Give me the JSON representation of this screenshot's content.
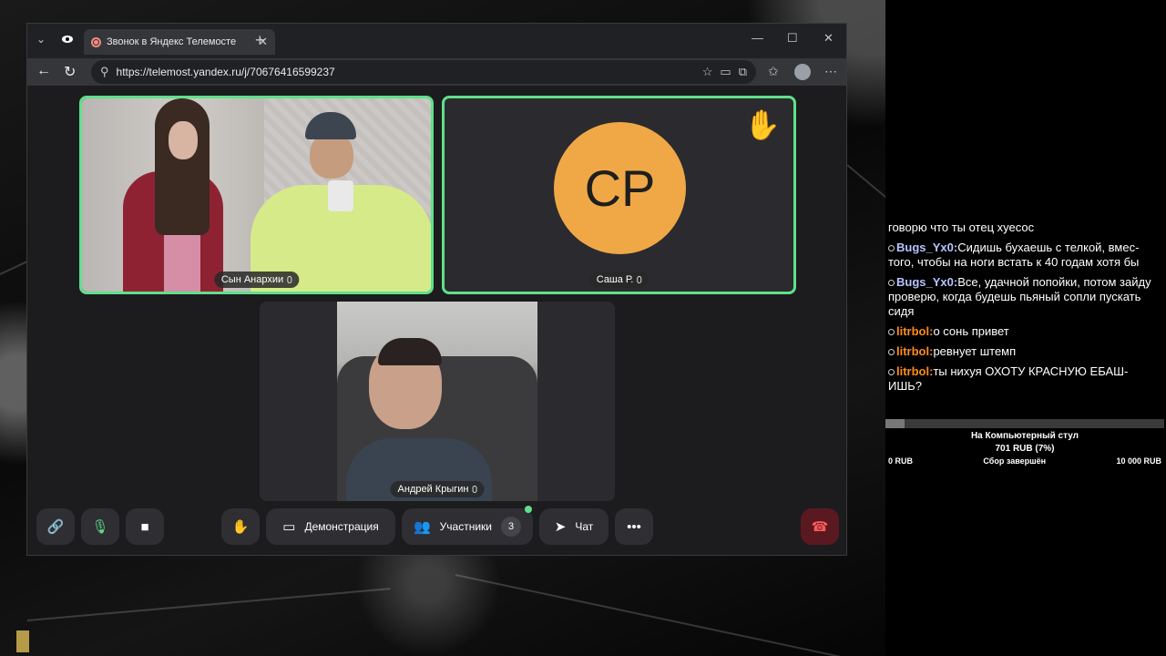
{
  "browser": {
    "tab_title": "Звонок в Яндекс Телемосте",
    "tab_close": "✕",
    "new_tab": "+",
    "url": "https://telemost.yandex.ru/j/70676416599237",
    "minimize": "—",
    "maximize": "☐",
    "close": "✕"
  },
  "call": {
    "participants": [
      {
        "name": "Сын Анархии",
        "speaking": true
      },
      {
        "name": "Саша Р.",
        "initials": "СР",
        "speaking": true,
        "hand_raised": true,
        "avatar_color": "#f0a847"
      },
      {
        "name": "Андрей Крыгин",
        "speaking": false
      }
    ],
    "controls": {
      "demo_label": "Демонстрация",
      "participants_label": "Участники",
      "participants_count": "3",
      "chat_label": "Чат",
      "more": "•••"
    },
    "accent_color": "#5fe08a"
  },
  "chat": {
    "messages": [
      {
        "user": "",
        "text": "говорю что ты отец хуесос"
      },
      {
        "user": "Bugs_Yx0:",
        "text": "Сидишь бухаешь с телкой, вмес-того, чтобы на ноги встать к 40 годам хотя бы"
      },
      {
        "user": "Bugs_Yx0:",
        "text": "Все, удачной попойки, потом зайду проверю, когда будешь пьяный сопли пускать сидя"
      },
      {
        "user": "litrbol:",
        "text": "о сонь привет"
      },
      {
        "user": "litrbol:",
        "text": "ревнует штемп"
      },
      {
        "user": "litrbol:",
        "text": "ты нихуя ОХОТУ КРАСНУЮ ЕБАШ-ИШЬ?"
      }
    ]
  },
  "goal": {
    "title": "На Компьютерный стул",
    "amount": "701 RUB (7%)",
    "progress": 0.07,
    "min": "0 RUB",
    "status": "Сбор завершён",
    "max": "10 000 RUB"
  }
}
